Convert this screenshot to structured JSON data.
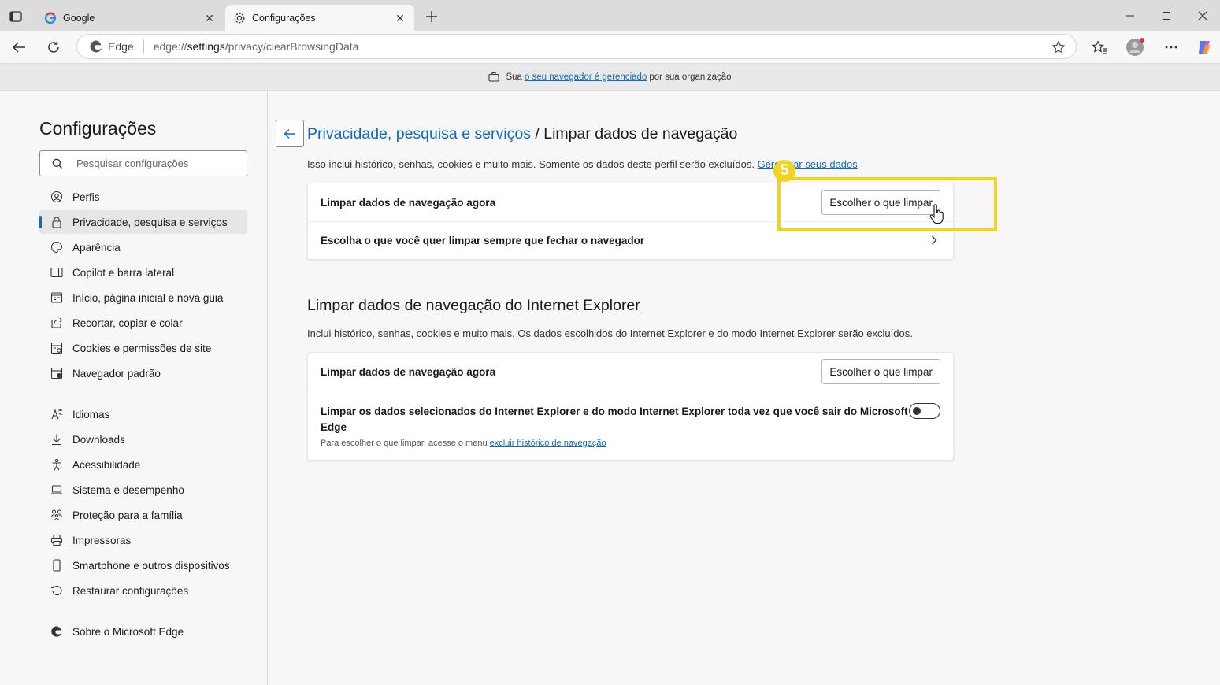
{
  "tabs": [
    {
      "title": "Google",
      "favicon": "google-icon",
      "active": false
    },
    {
      "title": "Configurações",
      "favicon": "gear-icon",
      "active": true
    }
  ],
  "address": {
    "site_label": "Edge",
    "url_prefix": "edge://",
    "url_host": "settings",
    "url_path": "/privacy/clearBrowsingData"
  },
  "infobar": {
    "prefix": "Sua",
    "link": "o seu navegador é gerenciado",
    "suffix": "por sua organização"
  },
  "sidebar": {
    "title": "Configurações",
    "search_placeholder": "Pesquisar configurações",
    "items": [
      {
        "label": "Perfis",
        "icon": "profile-icon"
      },
      {
        "label": "Privacidade, pesquisa e serviços",
        "icon": "lock-icon",
        "selected": true
      },
      {
        "label": "Aparência",
        "icon": "appearance-icon"
      },
      {
        "label": "Copilot e barra lateral",
        "icon": "sidebar-icon"
      },
      {
        "label": "Início, página inicial e nova guia",
        "icon": "home-page-icon"
      },
      {
        "label": "Recortar, copiar e colar",
        "icon": "share-icon"
      },
      {
        "label": "Cookies e permissões de site",
        "icon": "cookies-icon"
      },
      {
        "label": "Navegador padrão",
        "icon": "default-browser-icon"
      },
      {
        "label": "Idiomas",
        "icon": "languages-icon"
      },
      {
        "label": "Downloads",
        "icon": "download-icon"
      },
      {
        "label": "Acessibilidade",
        "icon": "accessibility-icon"
      },
      {
        "label": "Sistema e desempenho",
        "icon": "laptop-icon"
      },
      {
        "label": "Proteção para a família",
        "icon": "family-icon"
      },
      {
        "label": "Impressoras",
        "icon": "printer-icon"
      },
      {
        "label": "Smartphone e outros dispositivos",
        "icon": "phone-icon"
      },
      {
        "label": "Restaurar configurações",
        "icon": "reset-icon"
      },
      {
        "label": "Sobre o Microsoft Edge",
        "icon": "edge-logo-icon"
      }
    ]
  },
  "main": {
    "breadcrumb_link": "Privacidade, pesquisa e serviços",
    "breadcrumb_sep": " / ",
    "breadcrumb_current": "Limpar dados de navegação",
    "desc1_text": "Isso inclui histórico, senhas, cookies e muito mais. Somente os dados deste perfil serão excluídos.",
    "desc1_link": "Gerenciar seus dados",
    "card1": {
      "row1_label": "Limpar dados de navegação agora",
      "row1_button": "Escolher o que limpar",
      "row2_label": "Escolha o que você quer limpar sempre que fechar o navegador"
    },
    "section2_title": "Limpar dados de navegação do Internet Explorer",
    "desc2_text": "Inclui histórico, senhas, cookies e muito mais. Os dados escolhidos do Internet Explorer e do modo Internet Explorer serão excluídos.",
    "card2": {
      "row1_label": "Limpar dados de navegação agora",
      "row1_button": "Escolher o que limpar",
      "row2_label_line1": "Limpar os dados selecionados do Internet Explorer e do modo Internet Explorer toda vez que você sair do Microsoft",
      "row2_label_line2": "Edge",
      "row2_toggle_on": false,
      "row2_note_text": "Para escolher o que limpar, acesse o menu",
      "row2_note_link": "excluir histórico de navegação"
    }
  },
  "annotation": {
    "step_number": "5",
    "highlight_color": "#f0d420"
  },
  "colors": {
    "accent": "#0f6cbd"
  }
}
